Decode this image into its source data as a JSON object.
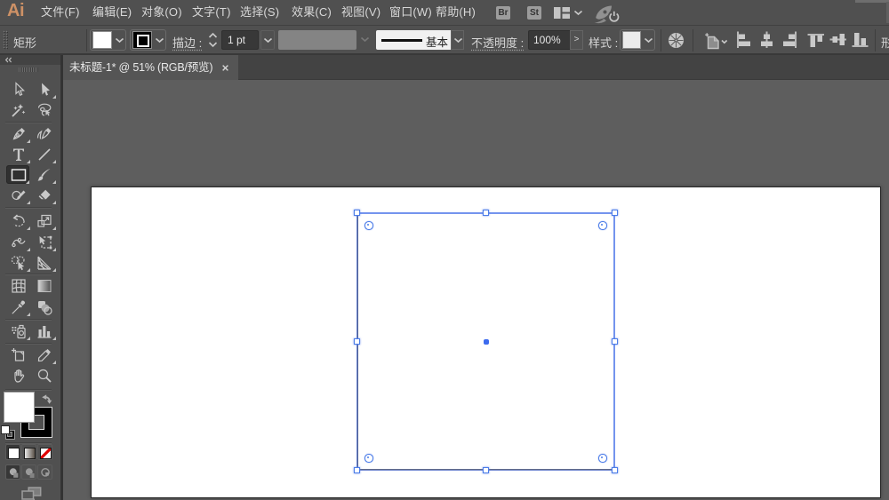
{
  "window": {
    "app": "Adobe Illustrator",
    "size": "1000x563"
  },
  "menubar": {
    "logo": "Ai",
    "items": [
      "文件(F)",
      "编辑(E)",
      "对象(O)",
      "文字(T)",
      "选择(S)",
      "效果(C)",
      "视图(V)",
      "窗口(W)",
      "帮助(H)"
    ],
    "bridge_badge": "Br",
    "stock_badge": "St",
    "right_icons": [
      "workspace-switcher-icon",
      "gpu-performance-rocket-icon"
    ]
  },
  "controlbar": {
    "context_label": "矩形",
    "fill_color": "#ffffff",
    "stroke_color": "#000000",
    "stroke_label": "描边 :",
    "stroke_weight": "1 pt",
    "width_profile": "基本",
    "opacity_label": "不透明度 :",
    "opacity_value": "100%",
    "opacity_more": ">",
    "style_label": "样式 :",
    "clipped_right_label": "形",
    "align_buttons": [
      "align-left",
      "align-h-center",
      "align-right",
      "align-top",
      "align-v-center",
      "align-bottom"
    ]
  },
  "document_tab": {
    "title": "未标题-1* @ 51% (RGB/预览)",
    "zoom": "51%",
    "mode": "RGB/预览"
  },
  "toolbar": {
    "tools": [
      "selection",
      "direct-selection",
      "magic-wand",
      "lasso",
      "pen",
      "curvature",
      "type",
      "line-segment",
      "rectangle",
      "paintbrush",
      "shaper",
      "eraser",
      "rotate",
      "scale",
      "width",
      "free-transform",
      "shape-builder",
      "perspective-grid",
      "mesh",
      "gradient",
      "eyedropper",
      "blend",
      "symbol-sprayer",
      "column-graph",
      "artboard",
      "slice",
      "hand",
      "zoom"
    ],
    "active_tool": "rectangle",
    "fill_color": "#ffffff",
    "stroke_color": "#000000"
  },
  "canvas": {
    "artboard_color": "#ffffff",
    "selection_color": "#4c7de8"
  }
}
